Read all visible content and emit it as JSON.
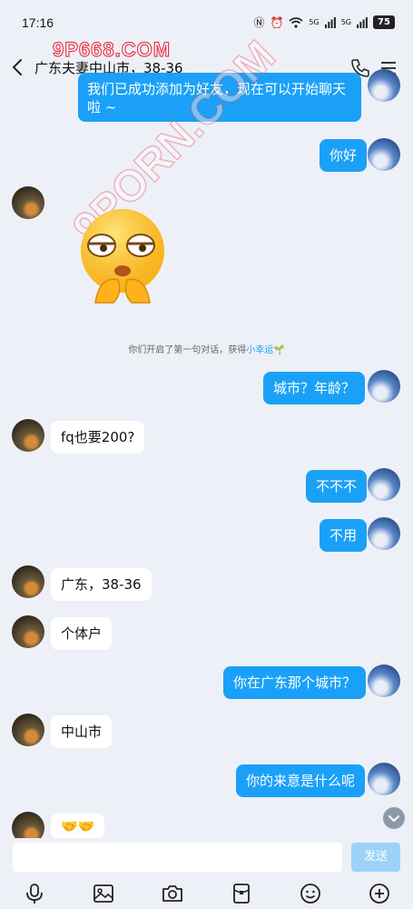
{
  "status_bar": {
    "time": "17:16",
    "battery": "75",
    "network_a": "5G",
    "network_b": "5G"
  },
  "watermark": {
    "top": "9P668.COM",
    "diagonal": "9PORN.COM"
  },
  "header": {
    "title": "广东夫妻中山市，38-36"
  },
  "top_message": {
    "text": "我们已成功添加为好友，现在可以开始聊天啦 ~"
  },
  "system_note": {
    "text": "你们开启了第一句对话，获得",
    "link": "小幸运"
  },
  "messages": [
    {
      "side": "me",
      "text": "你好"
    },
    {
      "side": "me",
      "text": "城市？年龄？"
    },
    {
      "side": "other",
      "text": "fq也要200?"
    },
    {
      "side": "me",
      "text": "不不不"
    },
    {
      "side": "me",
      "text": "不用"
    },
    {
      "side": "other",
      "text": "广东，38-36"
    },
    {
      "side": "other",
      "text": "个体户"
    },
    {
      "side": "me",
      "text": "你在广东那个城市？"
    },
    {
      "side": "other",
      "text": "中山市"
    },
    {
      "side": "me",
      "text": "你的来意是什么呢"
    },
    {
      "side": "other",
      "text": "🤝🤝"
    }
  ],
  "input": {
    "placeholder": "",
    "send_label": "发送"
  },
  "toolbar": {
    "icons": [
      "microphone-icon",
      "image-icon",
      "camera-icon",
      "red-packet-icon",
      "emoji-icon",
      "plus-icon"
    ]
  },
  "colors": {
    "my_bubble": "#1aa1f7",
    "other_bubble": "#ffffff",
    "background": "#eef0f7",
    "send_button": "#9dd2f9"
  }
}
